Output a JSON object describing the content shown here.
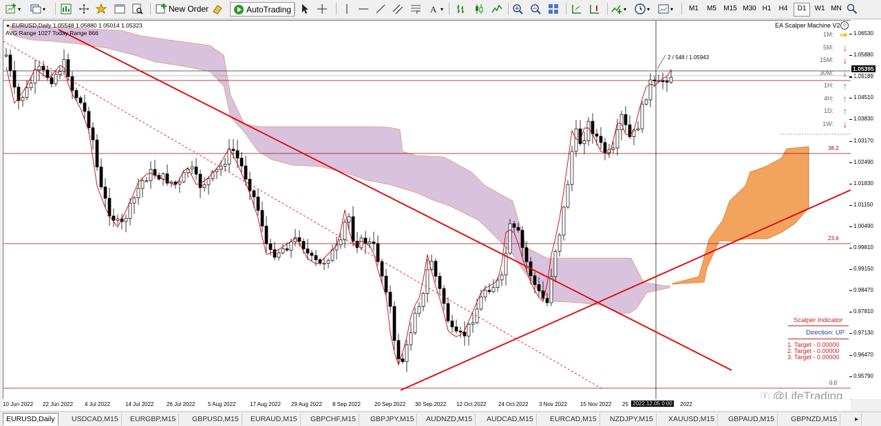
{
  "toolbar": {
    "new_order": "New Order",
    "auto_trading": "AutoTrading",
    "timeframes": [
      "M1",
      "M5",
      "M15",
      "M30",
      "H1",
      "H4",
      "D1",
      "W1",
      "MN"
    ],
    "active_timeframe": "D1"
  },
  "chart": {
    "symbol_line": "EURUSD,Daily  1.05548 1.05880 1.05014 1.05323",
    "avg_range": "AVG Range 1027   Today Range 866",
    "ea_title": "EA Scalper Machine V2",
    "trend_rows": [
      {
        "tf": "1M:",
        "dir": "right",
        "color": "#f0b400"
      },
      {
        "tf": "5M:",
        "dir": "down",
        "color": "#d21f1f"
      },
      {
        "tf": "15M:",
        "dir": "down",
        "color": "#d21f1f"
      },
      {
        "tf": "30M:",
        "dir": "down",
        "color": "#d21f1f"
      },
      {
        "tf": "1H:",
        "dir": "up",
        "color": "#2b8de0"
      },
      {
        "tf": "4H:",
        "dir": "up",
        "color": "#2b8de0"
      },
      {
        "tf": "1D:",
        "dir": "up",
        "color": "#2b8de0"
      },
      {
        "tf": "1W:",
        "dir": "down",
        "color": "#d21f1f"
      }
    ],
    "crosshair_label": "2 / 548 / 1.05943",
    "fib_levels": [
      "38.2",
      "23.6",
      "0.0"
    ],
    "scalper": {
      "title": "Scalper Indicator",
      "direction": "Direction: UP",
      "targets": [
        "1. Target - 0.00000",
        "2. Target - 0.00000",
        "3. Target - 0.00000"
      ]
    },
    "watermark": "@LifeTrading"
  },
  "price_scale": {
    "labels": [
      "1.06530",
      "1.05880",
      "1.05180",
      "1.04510",
      "1.03830",
      "1.03170",
      "1.02490",
      "1.01830",
      "1.01150",
      "1.00490",
      "0.99810",
      "0.99150",
      "0.98470",
      "0.97810",
      "0.97130",
      "0.96470",
      "0.95790"
    ],
    "current": "1.05395",
    "hidden_partial": "1.05181"
  },
  "time_axis": {
    "labels": [
      "10 Jun 2022",
      "22 Jun 2022",
      "4 Jul 2022",
      "14 Jul 2022",
      "26 Jul 2022",
      "5 Aug 2022",
      "17 Aug 2022",
      "29 Aug 2022",
      "8 Sep 2022",
      "20 Sep 2022",
      "30 Sep 2022",
      "12 Oct 2022",
      "24 Oct 2022",
      "3 Nov 2022",
      "15 Nov 2022",
      "25"
    ],
    "highlight": "2022.12.05 0:00",
    "tail": "2022"
  },
  "tabs": [
    "EURUSD,Daily",
    "USDCAD,M15",
    "EURGBP,M15",
    "GBPUSD,M15",
    "EURAUD,M15",
    "GBPCHF,M15",
    "GBPJPY,M15",
    "AUDNZD,M15",
    "AUDCAD,M15",
    "EURCAD,M15",
    "NZDJPY,M15",
    "XAUUSD,M15",
    "GBPAUD,M15",
    "GBPNZD,M15"
  ],
  "colors": {
    "cloud": "#d7bfdc",
    "future_cloud": "#f2a35e",
    "trendline": "#e01010",
    "ma": "#cc0000",
    "fib": "#8b1010"
  }
}
